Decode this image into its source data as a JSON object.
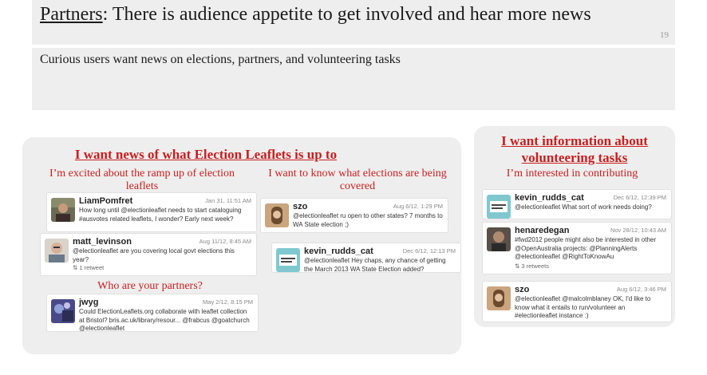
{
  "slide": {
    "title_word": "Partners",
    "title_rest": ": There is audience appetite to get involved and hear more news",
    "page_number": "19",
    "subtitle": "Curious users want news on elections, partners, and volunteering tasks"
  },
  "left_panel": {
    "heading": "I want news of what Election Leaflets is up to",
    "quote_ramp": "I’m excited about the ramp up of election leaflets",
    "quote_elections": "I want to know what elections are being covered",
    "quote_partners": "Who are your partners?"
  },
  "right_panel": {
    "heading": "I want information about volunteering tasks",
    "quote": "I’m interested in contributing"
  },
  "tweets": {
    "liam": {
      "name": "LiamPomfret",
      "time": "Jan 31, 11:51 AM",
      "text": "How long until @electionleaflet needs to start cataloguing #ausvotes related leaflets, I wonder? Early next week?"
    },
    "matt": {
      "name": "matt_levinson",
      "time": "Aug 11/12, 8:45 AM",
      "text": "@electionleaflet are you covering local govt elections this year?",
      "retweets": "⇅ 1 retweet"
    },
    "jwyg": {
      "name": "jwyg",
      "time": "May 2/12, 8:15 PM",
      "text": "Could ElectionLeaflets.org collaborate with leaflet collection at Bristol? bris.ac.uk/library/resour... @frabcus @goatchurch @electionleaflet"
    },
    "szo1": {
      "name": "szo",
      "time": "Aug 6/12, 1:29 PM",
      "text": "@electionleaflet ru open to other states? 7 months to WA State election ;)"
    },
    "kevin1": {
      "name": "kevin_rudds_cat",
      "time": "Dec 6/12, 12:13 PM",
      "text": "@electionleaflet Hey chaps, any chance of getting the March 2013 WA State Election added?"
    },
    "kevin2": {
      "name": "kevin_rudds_cat",
      "time": "Dec 6/12, 12:39 PM",
      "text": "@electionleaflet What sort of work needs doing?"
    },
    "henare": {
      "name": "henaredegan",
      "time": "Nov 28/12, 10:43 AM",
      "text": "#fwd2012 people might also be interested in other @OpenAustralia projects: @PlanningAlerts @electionleaflet @RightToKnowAu",
      "retweets": "⇅ 3 retweets"
    },
    "szo2": {
      "name": "szo",
      "time": "Aug 6/12, 3:46 PM",
      "text": "@electionleaflet @malcolmblaney OK, I'd like to know what it entails to run/volunteer an #electionleaflet instance :)"
    }
  },
  "colors": {
    "accent_red": "#c81e1e",
    "panel_grey": "#eeeeee"
  }
}
